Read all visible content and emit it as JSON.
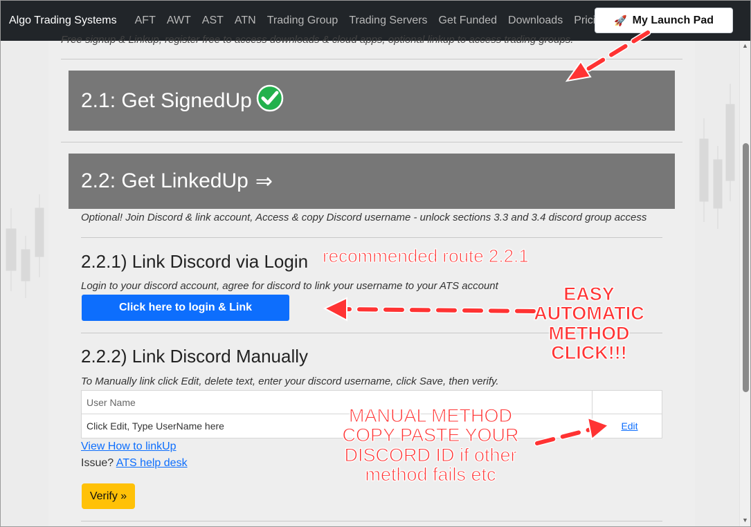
{
  "navbar": {
    "brand": "Algo Trading Systems",
    "items": [
      "AFT",
      "AWT",
      "AST",
      "ATN",
      "Trading Group",
      "Trading Servers",
      "Get Funded",
      "Downloads",
      "Pricing"
    ],
    "launch_label": "My Launch Pad",
    "launch_icon": "rocket-icon"
  },
  "intro_text": "Free signup & Linkup, register free to access downloads & cloud apps, optional linkup to access trading groups.",
  "step1": {
    "title": "2.1: Get SignedUp",
    "icon": "check-circle-icon"
  },
  "step2": {
    "title": "2.2: Get LinkedUp",
    "arrow": "⇒",
    "optional_text": "Optional! Join Discord & link account, Access & copy Discord username - unlock sections 3.3 and 3.4 discord group access"
  },
  "section_221": {
    "heading": "2.2.1) Link Discord via Login",
    "desc": "Login to your discord account, agree for discord to link your username to your ATS account",
    "button_label": "Click here to login & Link"
  },
  "section_222": {
    "heading": "2.2.2) Link Discord Manually",
    "desc": "To Manually link click Edit, delete text, enter your discord username, click Save, then verify.",
    "table": {
      "header": "User Name",
      "value": "Click Edit, Type UserName here",
      "edit_label": "Edit"
    },
    "howto_link": "View How to linkUp",
    "issue_prefix": "Issue?",
    "helpdesk_link": "ATS help desk",
    "verify_label": "Verify »"
  },
  "annotations": {
    "recommended": "recommended route 2.2.1",
    "easy_lines": [
      "EASY",
      "AUTOMATIC",
      "METHOD",
      "CLICK!!!"
    ],
    "manual_lines": [
      "MANUAL METHOD",
      "COPY PASTE YOUR",
      "DISCORD ID  if other",
      "method fails etc"
    ]
  },
  "colors": {
    "navbar_bg": "#212529",
    "step_box_bg": "#777777",
    "primary_blue": "#0d6efd",
    "verify_yellow": "#ffc107",
    "annotation_red": "#ff3333",
    "check_green": "#22b14c"
  }
}
